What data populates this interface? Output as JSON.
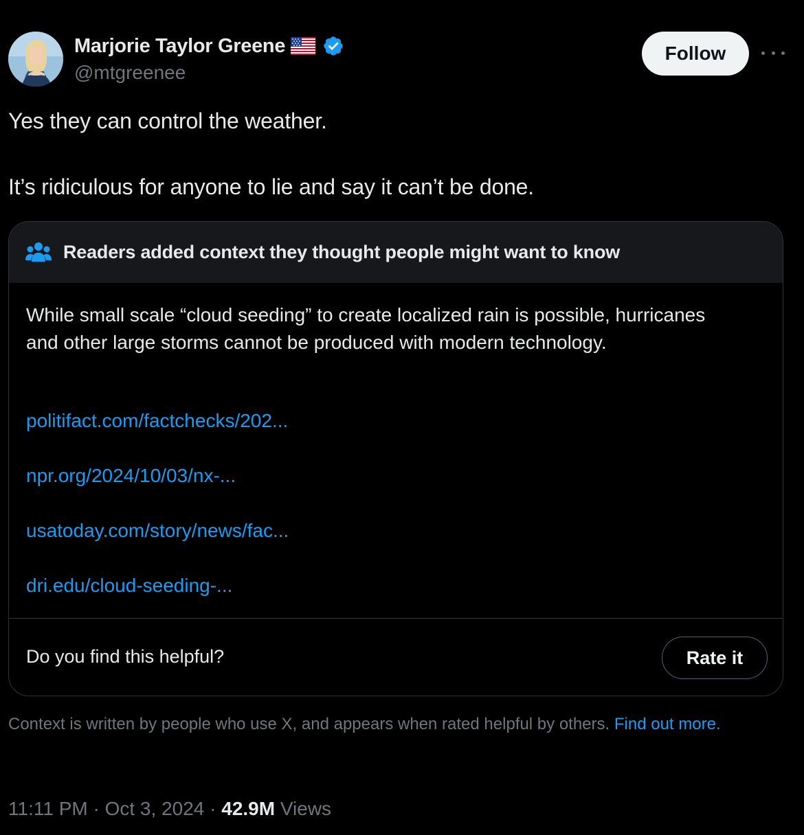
{
  "author": {
    "name": "Marjorie Taylor Greene",
    "handle": "@mtgreenee",
    "flag_icon": "us-flag-icon",
    "verified_icon": "verified-badge-icon",
    "verified_color": "#1d9bf0"
  },
  "actions": {
    "follow_label": "Follow",
    "more_icon": "more-dots-icon"
  },
  "tweet": {
    "line1": "Yes they can control the weather.",
    "line2": "It’s ridiculous for anyone to lie and say it can’t be done."
  },
  "community_note": {
    "header_icon": "people-icon",
    "header": "Readers added context they thought people might want to know",
    "body": "While small scale “cloud seeding” to create localized rain is possible, hurricanes and other large storms cannot be produced with modern technology.",
    "links": [
      "politifact.com/factchecks/202...",
      "npr.org/2024/10/03/nx-...",
      "usatoday.com/story/news/fac...",
      "dri.edu/cloud-seeding-..."
    ],
    "helpful_question": "Do you find this helpful?",
    "rate_label": "Rate it"
  },
  "disclaimer": {
    "text": "Context is written by people who use X, and appears when rated helpful by others.",
    "link_text": "Find out more."
  },
  "meta": {
    "time": "11:11 PM",
    "separator": "·",
    "date": "Oct 3, 2024",
    "views_count": "42.9M",
    "views_label": "Views"
  },
  "colors": {
    "background": "#000000",
    "text": "#e7e9ea",
    "muted": "#71767b",
    "link": "#1d9bf0",
    "border": "#2f3336"
  }
}
